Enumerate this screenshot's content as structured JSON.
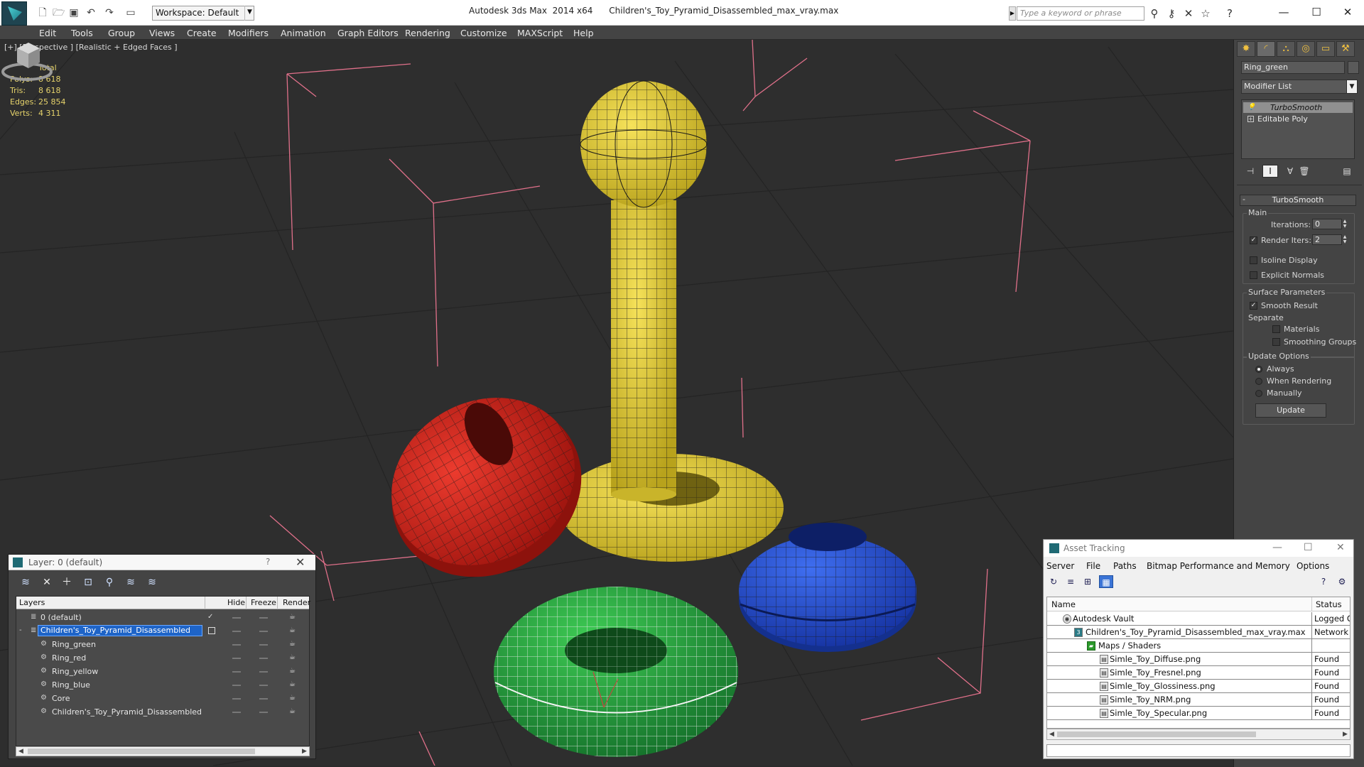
{
  "titlebar": {
    "workspace": "Workspace: Default",
    "app_title": "Autodesk 3ds Max  2014 x64",
    "file_name": "Children's_Toy_Pyramid_Disassembled_max_vray.max",
    "search_placeholder": "Type a keyword or phrase"
  },
  "menu": [
    "Edit",
    "Tools",
    "Group",
    "Views",
    "Create",
    "Modifiers",
    "Animation",
    "Graph Editors",
    "Rendering",
    "Customize",
    "MAXScript",
    "Help"
  ],
  "viewport": {
    "label": "[+] [Perspective ] [Realistic + Edged Faces ]",
    "stats": {
      "header": "Total",
      "rows": [
        {
          "label": "Polys:",
          "value": "8 618"
        },
        {
          "label": "Tris:",
          "value": "8 618"
        },
        {
          "label": "Edges:",
          "value": "25 854"
        },
        {
          "label": "Verts:",
          "value": "4 311"
        }
      ]
    },
    "object_colors": {
      "yellow": "#e8d43a",
      "red": "#d8231c",
      "green": "#22a23a",
      "blue": "#1f4fd8",
      "wire": "#1a1a1a",
      "bbox": "#e0708a"
    }
  },
  "command_panel": {
    "object_name": "Ring_green",
    "modifier_list": "Modifier List",
    "stack": [
      "TurboSmooth",
      "Editable Poly"
    ],
    "rollout_title": "TurboSmooth",
    "main_group": "Main",
    "iterations_label": "Iterations:",
    "iterations_value": "0",
    "render_iters_label": "Render Iters:",
    "render_iters_value": "2",
    "isoline_display": "Isoline Display",
    "explicit_normals": "Explicit Normals",
    "surface_group": "Surface Parameters",
    "smooth_result": "Smooth Result",
    "separate": "Separate",
    "materials": "Materials",
    "smoothing_groups": "Smoothing Groups",
    "update_group": "Update Options",
    "always": "Always",
    "when_rendering": "When Rendering",
    "manually": "Manually",
    "update_button": "Update"
  },
  "layer_window": {
    "title": "Layer: 0 (default)",
    "help": "?",
    "columns": {
      "layers": "Layers",
      "hide": "Hide",
      "freeze": "Freeze",
      "render": "Render"
    },
    "rows": [
      {
        "name": "0 (default)"
      },
      {
        "name": "Children's_Toy_Pyramid_Disassembled"
      },
      {
        "name": "Ring_green"
      },
      {
        "name": "Ring_red"
      },
      {
        "name": "Ring_yellow"
      },
      {
        "name": "Ring_blue"
      },
      {
        "name": "Core"
      },
      {
        "name": "Children's_Toy_Pyramid_Disassembled"
      }
    ]
  },
  "asset_window": {
    "title": "Asset Tracking",
    "menu": [
      "Server",
      "File",
      "Paths",
      "Bitmap Performance and Memory",
      "Options"
    ],
    "columns": {
      "name": "Name",
      "status": "Status"
    },
    "rows": [
      {
        "name": "Autodesk Vault",
        "status": "Logged O"
      },
      {
        "name": "Children's_Toy_Pyramid_Disassembled_max_vray.max",
        "status": "Network F"
      },
      {
        "name": "Maps / Shaders",
        "status": ""
      },
      {
        "name": "Simle_Toy_Diffuse.png",
        "status": "Found"
      },
      {
        "name": "Simle_Toy_Fresnel.png",
        "status": "Found"
      },
      {
        "name": "Simle_Toy_Glossiness.png",
        "status": "Found"
      },
      {
        "name": "Simle_Toy_NRM.png",
        "status": "Found"
      },
      {
        "name": "Simle_Toy_Specular.png",
        "status": "Found"
      }
    ]
  }
}
